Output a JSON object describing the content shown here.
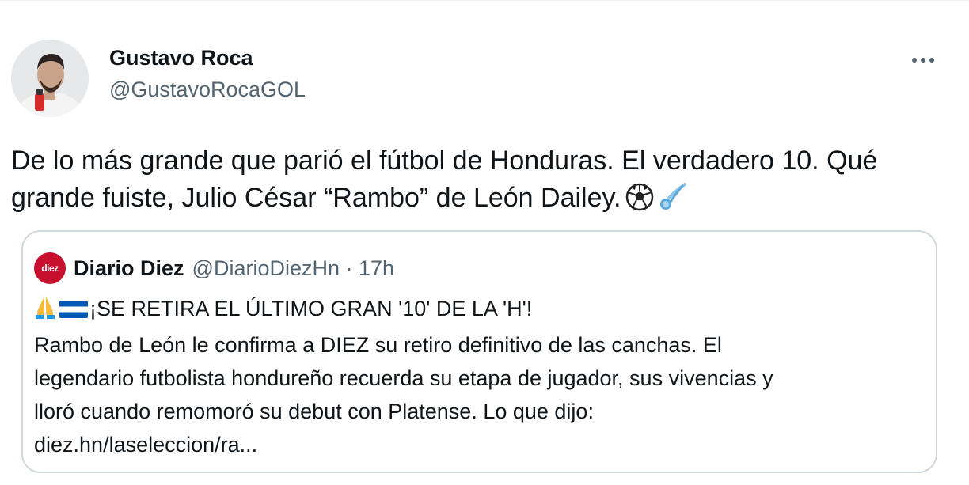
{
  "author": {
    "name": "Gustavo Roca",
    "handle": "@GustavoRocaGOL"
  },
  "tweet": {
    "line1": "De lo más grande que parió el fútbol de Honduras. El verdadero 10. Qué",
    "line2": "grande fuiste, Julio César “Rambo” de León Dailey.",
    "emojis": [
      "soccer-ball-icon",
      "comet-icon"
    ]
  },
  "quote": {
    "logo_text": "diez",
    "name": "Diario Diez",
    "meta": "@DiarioDiezHn · 17h",
    "headline": "¡SE RETIRA EL ÚLTIMO GRAN '10' DE LA 'H'!",
    "body_line1": "Rambo de León le confirma a DIEZ su retiro definitivo de las canchas. El",
    "body_line2": "legendario futbolista hondureño recuerda su etapa de jugador, sus vivencias y",
    "body_line3": "lloró cuando remomoró su debut con Platense. Lo que dijo:",
    "link": "diez.hn/laseleccion/ra..."
  },
  "icons": {
    "more": "more-icon",
    "headline_prefix": [
      "folded-hands-icon",
      "honduras-flag-icon"
    ]
  },
  "colors": {
    "text": "#0f1419",
    "secondary": "#536471",
    "border": "#cfd9de",
    "diez_red": "#c8102e"
  }
}
